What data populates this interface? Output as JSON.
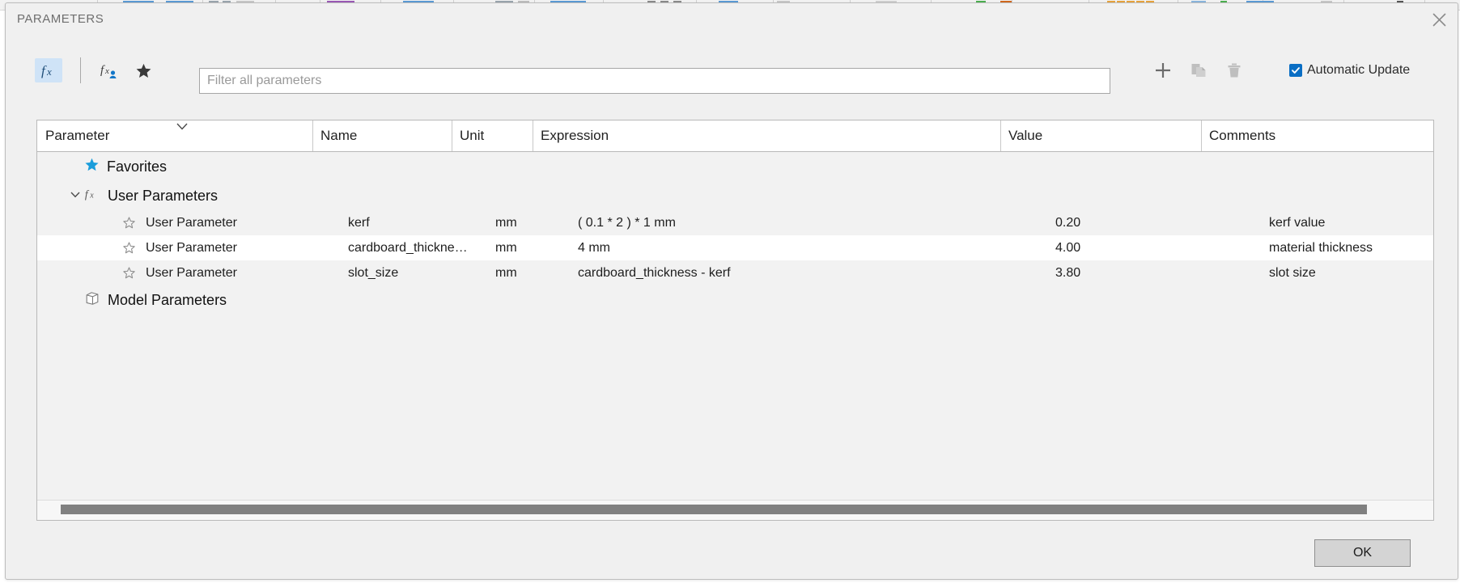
{
  "dialog": {
    "title": "PARAMETERS",
    "close_icon": "close-icon"
  },
  "toolbar": {
    "fx_all_icon": "fx-icon",
    "fx_user_icon": "fx-user-icon",
    "favorites_icon": "star-icon",
    "add_icon": "plus-icon",
    "copy_icon": "copy-icon",
    "delete_icon": "trash-icon",
    "automatic_update_label": "Automatic Update",
    "automatic_update_checked": true,
    "accent_color": "#0a6ec4"
  },
  "filter": {
    "value": "",
    "placeholder": "Filter all parameters"
  },
  "table": {
    "columns": [
      "Parameter",
      "Name",
      "Unit",
      "Expression",
      "Value",
      "Comments"
    ],
    "sort_indicator_icon": "chevron-down-icon",
    "groups": [
      {
        "label": "Favorites",
        "icon": "star-filled-icon",
        "expandable": false,
        "expanded": false,
        "rows": []
      },
      {
        "label": "User Parameters",
        "icon": "fx-icon",
        "expandable": true,
        "expanded": true,
        "rows": [
          {
            "favorite_icon": "star-outline-icon",
            "parameter": "User Parameter",
            "name": "kerf",
            "unit": "mm",
            "expression": "( 0.1 * 2 ) * 1 mm",
            "value": "0.20",
            "comments": "kerf value",
            "highlighted": false
          },
          {
            "favorite_icon": "star-outline-icon",
            "parameter": "User Parameter",
            "name": "cardboard_thickne…",
            "unit": "mm",
            "expression": "4 mm",
            "value": "4.00",
            "comments": "material thickness",
            "highlighted": true
          },
          {
            "favorite_icon": "star-outline-icon",
            "parameter": "User Parameter",
            "name": "slot_size",
            "unit": "mm",
            "expression": "cardboard_thickness - kerf",
            "value": "3.80",
            "comments": "slot size",
            "highlighted": false
          }
        ]
      },
      {
        "label": "Model Parameters",
        "icon": "cube-icon",
        "expandable": false,
        "expanded": false,
        "rows": []
      }
    ]
  },
  "footer": {
    "ok_label": "OK"
  }
}
